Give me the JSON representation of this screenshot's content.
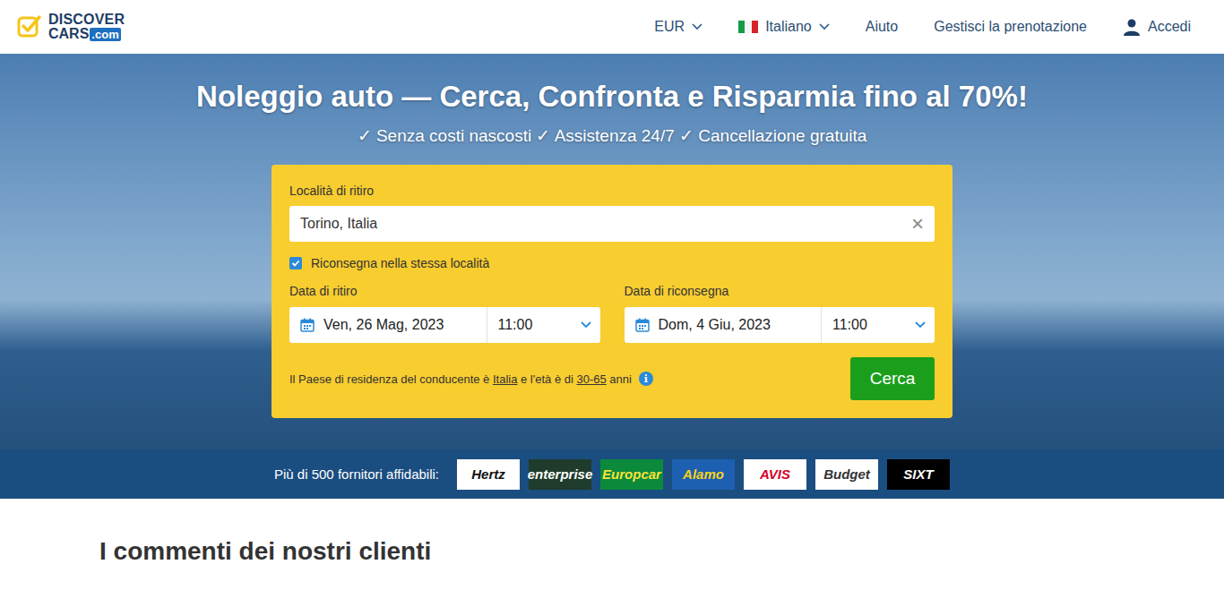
{
  "logo": {
    "word_top": "DISCOVER",
    "word_bottom": "CARS",
    "suffix": ".com"
  },
  "nav": {
    "currency": "EUR",
    "language": "Italiano",
    "help": "Aiuto",
    "manage": "Gestisci la prenotazione",
    "login": "Accedi"
  },
  "hero": {
    "title": "Noleggio auto — Cerca, Confronta e Risparmia fino al 70%!",
    "subtitle": "✓ Senza costi nascosti ✓ Assistenza 24/7 ✓ Cancellazione gratuita"
  },
  "search": {
    "pickup_label": "Località di ritiro",
    "pickup_value": "Torino, Italia",
    "clear": "×",
    "same_location": {
      "label": "Riconsegna nella stessa località",
      "checked": true
    },
    "dates": [
      {
        "label": "Data di ritiro",
        "date": "Ven, 26 Mag, 2023",
        "time": "11:00"
      },
      {
        "label": "Data di riconsegna",
        "date": "Dom, 4 Giu, 2023",
        "time": "11:00"
      }
    ],
    "residency": [
      {
        "text": "Il Paese di residenza del conducente è ",
        "link": false
      },
      {
        "text": "Italia",
        "link": true
      },
      {
        "text": " e l'età è di ",
        "link": false
      },
      {
        "text": "30-65",
        "link": true
      },
      {
        "text": " anni",
        "link": false
      }
    ],
    "info": "i",
    "button": "Cerca"
  },
  "providers": {
    "label": "Più di 500 fornitori affidabili:",
    "items": [
      {
        "name": "Hertz",
        "color": "#ffffff",
        "text_color": "#111111"
      },
      {
        "name": "enterprise",
        "color": "#1f3b2c",
        "text_color": "#ffffff"
      },
      {
        "name": "Europcar",
        "color": "#0b8a3c",
        "text_color": "#f6e33a"
      },
      {
        "name": "Alamo",
        "color": "#1d5fb0",
        "text_color": "#f7d21c"
      },
      {
        "name": "AVIS",
        "color": "#ffffff",
        "text_color": "#d4002a"
      },
      {
        "name": "Budget",
        "color": "#ffffff",
        "text_color": "#333333"
      },
      {
        "name": "SIXT",
        "color": "#000000",
        "text_color": "#ffffff"
      }
    ]
  },
  "reviews": {
    "title": "I commenti dei nostri clienti"
  }
}
